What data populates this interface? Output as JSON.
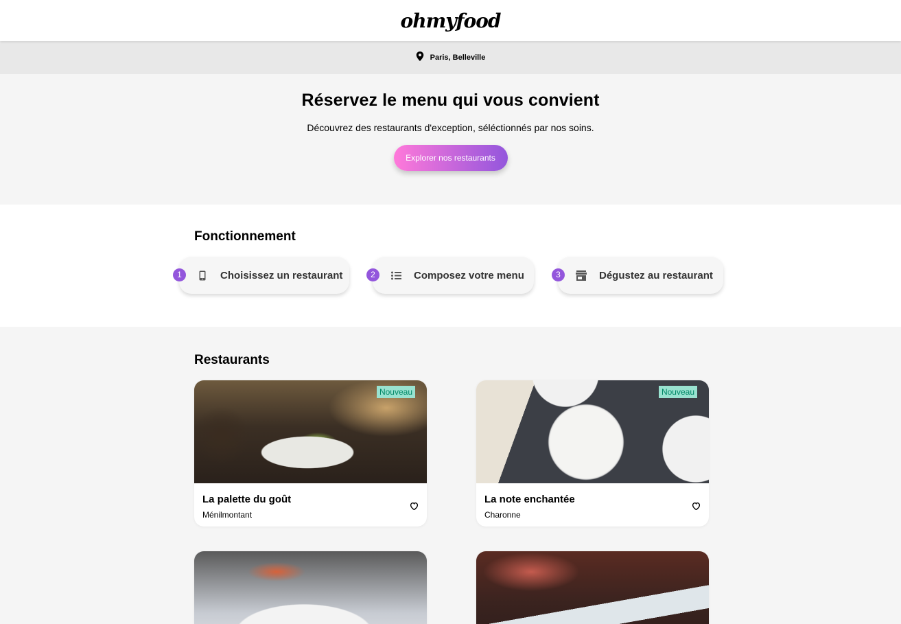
{
  "header": {
    "logo": "ohmyfood"
  },
  "location": {
    "icon": "map-pin-icon",
    "text": "Paris, Belleville"
  },
  "hero": {
    "title": "Réservez le menu qui vous convient",
    "subtitle": "Découvrez des restaurants d'exception, séléctionnés par nos soins.",
    "cta_label": "Explorer nos restaurants"
  },
  "howto": {
    "title": "Fonctionnement",
    "steps": [
      {
        "number": "1",
        "icon": "smartphone-icon",
        "label": "Choisissez un restaurant"
      },
      {
        "number": "2",
        "icon": "list-icon",
        "label": "Composez votre menu"
      },
      {
        "number": "3",
        "icon": "store-icon",
        "label": "Dégustez au restaurant"
      }
    ]
  },
  "restaurants": {
    "title": "Restaurants",
    "cards": [
      {
        "name": "La palette du goût",
        "area": "Ménilmontant",
        "badge": "Nouveau"
      },
      {
        "name": "La note enchantée",
        "area": "Charonne",
        "badge": "Nouveau"
      },
      {
        "name": "",
        "area": "",
        "badge": ""
      },
      {
        "name": "",
        "area": "",
        "badge": ""
      }
    ]
  },
  "colors": {
    "accent_start": "#ff79da",
    "accent_end": "#9356dc",
    "badge_bg": "#99e2d0",
    "badge_text": "#008766"
  }
}
